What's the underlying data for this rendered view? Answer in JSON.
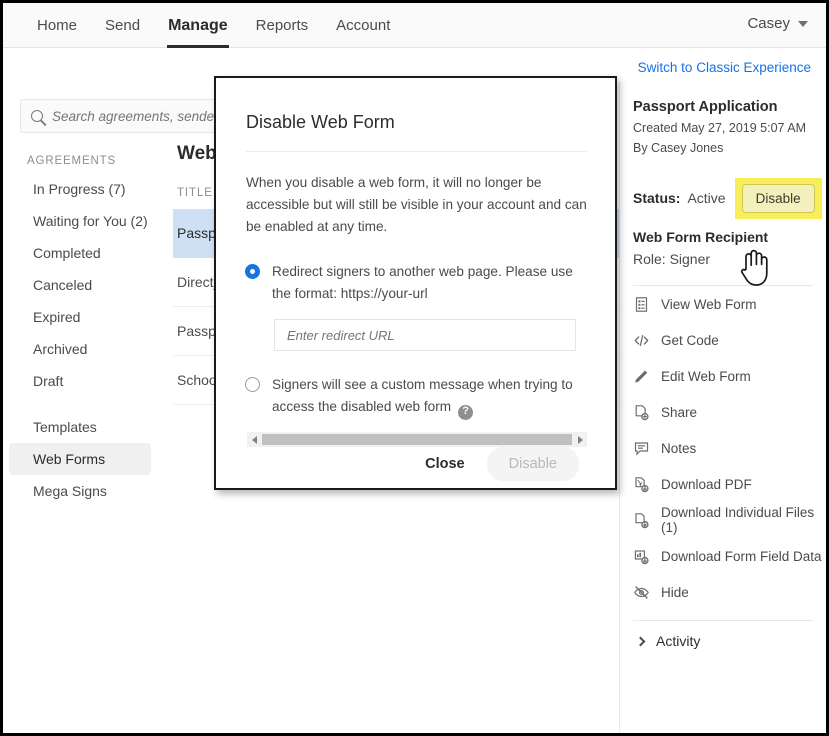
{
  "topnav": {
    "items": [
      {
        "label": "Home",
        "active": false
      },
      {
        "label": "Send",
        "active": false
      },
      {
        "label": "Manage",
        "active": true
      },
      {
        "label": "Reports",
        "active": false
      },
      {
        "label": "Account",
        "active": false
      }
    ],
    "user": "Casey"
  },
  "switch_link": "Switch to Classic Experience",
  "search": {
    "value": "",
    "placeholder": "Search agreements, senders, recipients"
  },
  "sidebar": {
    "heading": "AGREEMENTS",
    "items": [
      {
        "label": "In Progress (7)",
        "selected": false
      },
      {
        "label": "Waiting for You (2)",
        "selected": false
      },
      {
        "label": "Completed",
        "selected": false
      },
      {
        "label": "Canceled",
        "selected": false
      },
      {
        "label": "Expired",
        "selected": false
      },
      {
        "label": "Archived",
        "selected": false
      },
      {
        "label": "Draft",
        "selected": false
      }
    ],
    "items2": [
      {
        "label": "Templates",
        "selected": false
      },
      {
        "label": "Web Forms",
        "selected": true
      },
      {
        "label": "Mega Signs",
        "selected": false
      }
    ]
  },
  "main": {
    "title": "Web Forms",
    "column_header": "TITLE",
    "rows": [
      {
        "title": "Passport Application",
        "selected": true
      },
      {
        "title": "Direct_Deposit_Form",
        "selected": false
      },
      {
        "title": "Passport Renewal",
        "selected": false
      },
      {
        "title": "School Registration",
        "selected": false
      }
    ]
  },
  "detail": {
    "title": "Passport Application",
    "created": "Created May 27, 2019 5:07 AM",
    "by": "By Casey Jones",
    "status_label": "Status:",
    "status_value": "Active",
    "disable_button": "Disable",
    "recipient_heading": "Web Form Recipient",
    "role": "Role: Signer",
    "actions": [
      {
        "label": "View Web Form",
        "icon": "document-list-icon"
      },
      {
        "label": "Get Code",
        "icon": "code-icon"
      },
      {
        "label": "Edit Web Form",
        "icon": "pencil-icon"
      },
      {
        "label": "Share",
        "icon": "share-document-icon"
      },
      {
        "label": "Notes",
        "icon": "comment-icon"
      },
      {
        "label": "Download PDF",
        "icon": "download-pdf-icon"
      },
      {
        "label": "Download Individual Files (1)",
        "icon": "download-file-icon"
      },
      {
        "label": "Download Form Field Data",
        "icon": "download-data-icon"
      },
      {
        "label": "Hide",
        "icon": "eye-slash-icon"
      }
    ],
    "activity": "Activity"
  },
  "modal": {
    "title": "Disable Web Form",
    "description": "When you disable a web form, it will no longer be accessible but will still be visible in your account and can be enabled at any time.",
    "option1": "Redirect signers to another web page. Please use the format: https://your-url",
    "option1_selected": true,
    "redirect_input": {
      "value": "",
      "placeholder": "Enter redirect URL"
    },
    "option2": "Signers will see a custom message when trying to access the disabled web form",
    "option2_selected": false,
    "help_glyph": "?",
    "close_label": "Close",
    "disable_label": "Disable"
  },
  "colors": {
    "accent_blue": "#1473e6",
    "link_blue": "#1473e6",
    "highlight_yellow": "#f7ee5a",
    "row_selected": "#cfe0f5"
  }
}
